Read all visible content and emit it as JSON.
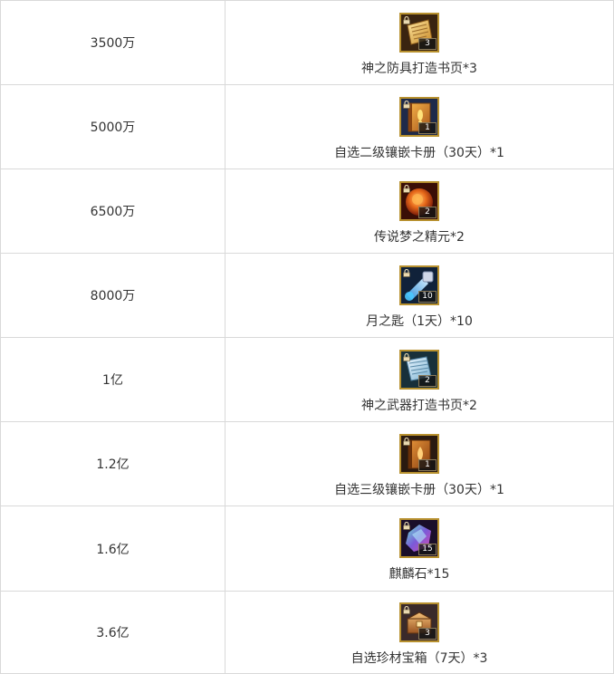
{
  "rows": [
    {
      "score": "3500万",
      "reward": "神之防具打造书页*3",
      "count": "3",
      "icon": "armor-scroll-icon",
      "icon_color": "#e0a93a"
    },
    {
      "score": "5000万",
      "reward": "自选二级镶嵌卡册（30天）*1",
      "count": "1",
      "icon": "card-album-icon",
      "icon_color": "#d9892a"
    },
    {
      "score": "6500万",
      "reward": "传说梦之精元*2",
      "count": "2",
      "icon": "dream-essence-icon",
      "icon_color": "#e0582a"
    },
    {
      "score": "8000万",
      "reward": "月之匙（1天）*10",
      "count": "10",
      "icon": "moon-key-icon",
      "icon_color": "#3aa8d8"
    },
    {
      "score": "1亿",
      "reward": "神之武器打造书页*2",
      "count": "2",
      "icon": "weapon-scroll-icon",
      "icon_color": "#9cc8e0"
    },
    {
      "score": "1.2亿",
      "reward": "自选三级镶嵌卡册（30天）*1",
      "count": "1",
      "icon": "card-album-icon",
      "icon_color": "#c8781a"
    },
    {
      "score": "1.6亿",
      "reward": "麒麟石*15",
      "count": "15",
      "icon": "qilin-stone-icon",
      "icon_color": "#7a5ad8"
    },
    {
      "score": "3.6亿",
      "reward": "自选珍材宝箱（7天）*3",
      "count": "3",
      "icon": "treasure-chest-icon",
      "icon_color": "#d89a4a"
    }
  ]
}
